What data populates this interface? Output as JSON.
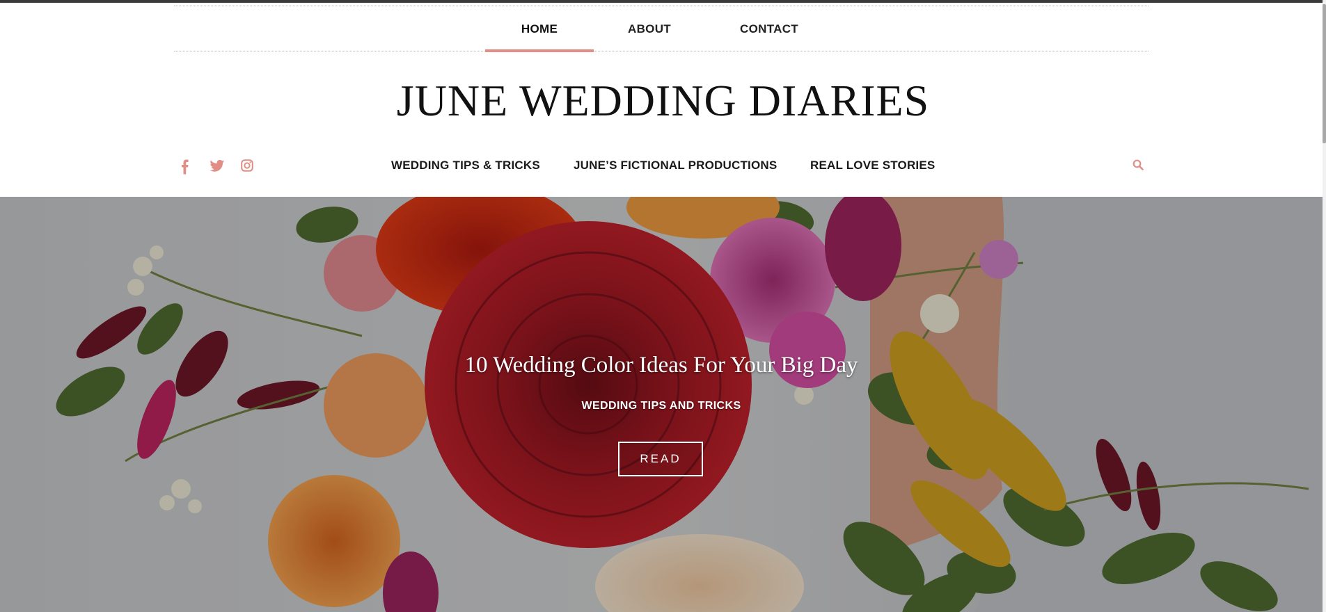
{
  "top_nav": {
    "items": [
      {
        "label": "HOME",
        "active": true
      },
      {
        "label": "ABOUT",
        "active": false
      },
      {
        "label": "CONTACT",
        "active": false
      }
    ]
  },
  "site": {
    "title": "JUNE WEDDING DIARIES"
  },
  "social": [
    "facebook-icon",
    "twitter-icon",
    "instagram-icon"
  ],
  "category_nav": {
    "items": [
      {
        "label": "WEDDING TIPS & TRICKS"
      },
      {
        "label": "JUNE’S FICTIONAL PRODUCTIONS"
      },
      {
        "label": "REAL LOVE STORIES"
      }
    ]
  },
  "hero": {
    "title": "10 Wedding Color Ideas For Your Big Day",
    "category": "WEDDING TIPS AND TRICKS",
    "button": "READ"
  },
  "colors": {
    "accent": "#e08e86",
    "text": "#1a1a1a"
  }
}
